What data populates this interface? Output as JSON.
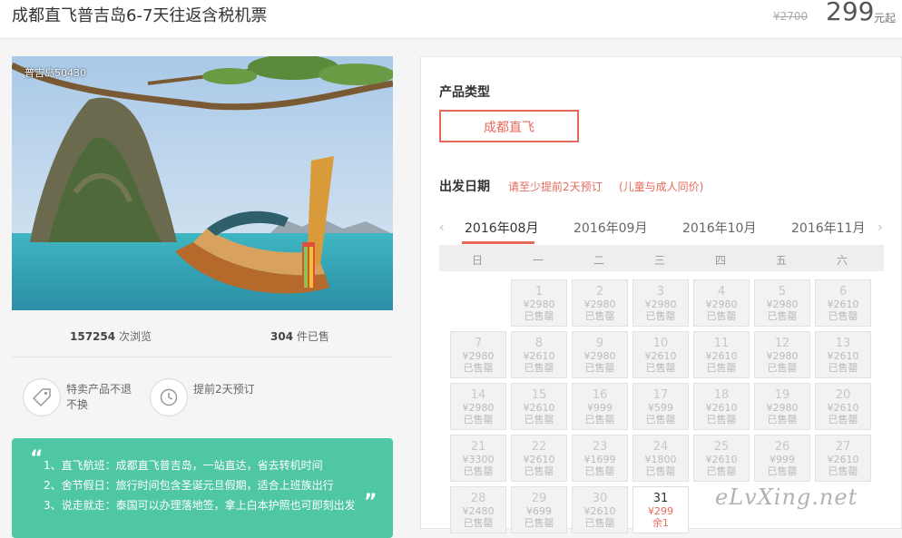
{
  "header": {
    "title": "成都直飞普吉岛6-7天往返含税机票",
    "old_price": "¥2700",
    "price": "299",
    "price_unit": "元起"
  },
  "gallery": {
    "photo_tag": "普吉岛50430"
  },
  "stats": {
    "views_count": "157254",
    "views_label": "次浏览",
    "sold_count": "304",
    "sold_label": "件已售"
  },
  "features": [
    {
      "icon": "tag-icon",
      "text": "特卖产品不退不换"
    },
    {
      "icon": "clock-icon",
      "text": "提前2天预订"
    }
  ],
  "tips": [
    "1、直飞航班：成都直飞普吉岛，一站直达，省去转机时间",
    "2、舍节假日：旅行时间包含圣诞元旦假期，适合上班族出行",
    "3、说走就走：泰国可以办理落地签，拿上白本护照也可即刻出发"
  ],
  "product": {
    "label": "产品类型",
    "option": "成都直飞"
  },
  "departure": {
    "label": "出发日期",
    "note1": "请至少提前2天预订",
    "note2": "(儿童与成人同价)"
  },
  "calendar": {
    "months": [
      "2016年08月",
      "2016年09月",
      "2016年10月",
      "2016年11月"
    ],
    "active_month": "2016年08月",
    "prev_arrow": "‹",
    "next_arrow": "›",
    "weekdays": [
      "日",
      "一",
      "二",
      "三",
      "四",
      "五",
      "六"
    ],
    "sold_out_label": "已售罄",
    "days": [
      {
        "day": "1",
        "price": "¥2980",
        "status": "已售罄"
      },
      {
        "day": "2",
        "price": "¥2980",
        "status": "已售罄"
      },
      {
        "day": "3",
        "price": "¥2980",
        "status": "已售罄"
      },
      {
        "day": "4",
        "price": "¥2980",
        "status": "已售罄"
      },
      {
        "day": "5",
        "price": "¥2980",
        "status": "已售罄"
      },
      {
        "day": "6",
        "price": "¥2610",
        "status": "已售罄"
      },
      {
        "day": "7",
        "price": "¥2980",
        "status": "已售罄"
      },
      {
        "day": "8",
        "price": "¥2610",
        "status": "已售罄"
      },
      {
        "day": "9",
        "price": "¥2980",
        "status": "已售罄"
      },
      {
        "day": "10",
        "price": "¥2610",
        "status": "已售罄"
      },
      {
        "day": "11",
        "price": "¥2610",
        "status": "已售罄"
      },
      {
        "day": "12",
        "price": "¥2980",
        "status": "已售罄"
      },
      {
        "day": "13",
        "price": "¥2610",
        "status": "已售罄"
      },
      {
        "day": "14",
        "price": "¥2980",
        "status": "已售罄"
      },
      {
        "day": "15",
        "price": "¥2610",
        "status": "已售罄"
      },
      {
        "day": "16",
        "price": "¥999",
        "status": "已售罄"
      },
      {
        "day": "17",
        "price": "¥599",
        "status": "已售罄"
      },
      {
        "day": "18",
        "price": "¥2610",
        "status": "已售罄"
      },
      {
        "day": "19",
        "price": "¥2980",
        "status": "已售罄"
      },
      {
        "day": "20",
        "price": "¥2610",
        "status": "已售罄"
      },
      {
        "day": "21",
        "price": "¥3300",
        "status": "已售罄"
      },
      {
        "day": "22",
        "price": "¥2610",
        "status": "已售罄"
      },
      {
        "day": "23",
        "price": "¥1699",
        "status": "已售罄"
      },
      {
        "day": "24",
        "price": "¥1800",
        "status": "已售罄"
      },
      {
        "day": "25",
        "price": "¥2610",
        "status": "已售罄"
      },
      {
        "day": "26",
        "price": "¥999",
        "status": "已售罄"
      },
      {
        "day": "27",
        "price": "¥2610",
        "status": "已售罄"
      },
      {
        "day": "28",
        "price": "¥2480",
        "status": "已售罄"
      },
      {
        "day": "29",
        "price": "¥699",
        "status": "已售罄"
      },
      {
        "day": "30",
        "price": "¥2610",
        "status": "已售罄"
      },
      {
        "day": "31",
        "price": "¥299",
        "status": "余1"
      }
    ]
  },
  "watermark": "eLvXing.net",
  "colors": {
    "accent": "#e66a5c",
    "tip_box": "#4fc7a4",
    "sold_out_cell": "#f2f2f2"
  }
}
